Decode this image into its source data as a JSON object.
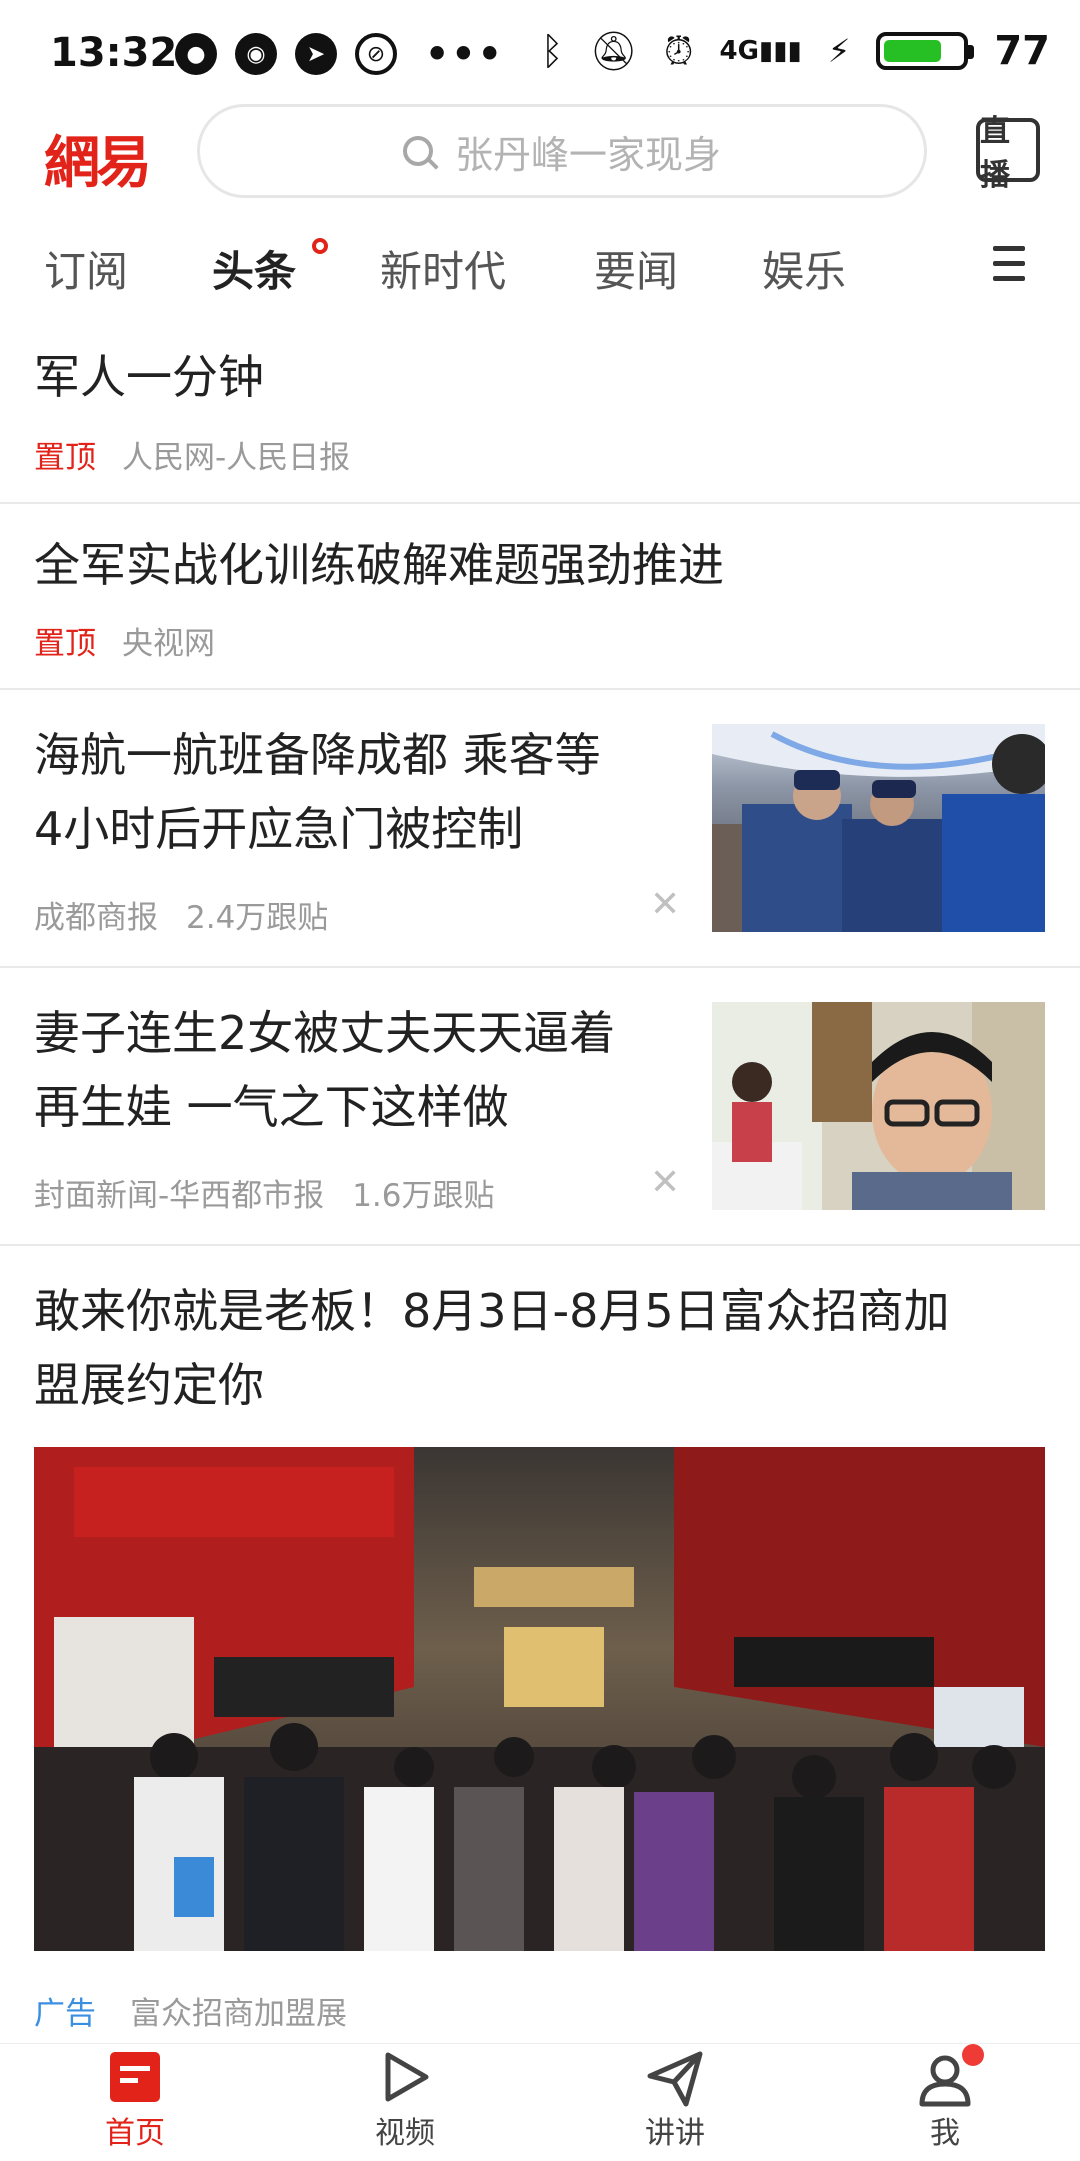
{
  "status_bar": {
    "time": "13:32",
    "network": "4G",
    "battery": "77",
    "battery_level": 0.77
  },
  "header": {
    "logo": "網易",
    "search_placeholder": "张丹峰一家现身",
    "live_label": "直播"
  },
  "tabs": [
    "订阅",
    "头条",
    "新时代",
    "要闻",
    "娱乐"
  ],
  "active_tab_index": 1,
  "feed": [
    {
      "title": "军人一分钟",
      "pin": "置顶",
      "source": "人民网-人民日报"
    },
    {
      "title": "全军实战化训练破解难题强劲推进",
      "pin": "置顶",
      "source": "央视网"
    },
    {
      "title_line1": "海航一航班备降成都 乘客等",
      "title_line2": "4小时后开应急门被控制",
      "source": "成都商报",
      "comments": "2.4万跟贴"
    },
    {
      "title_line1": "妻子连生2女被丈夫天天逼着",
      "title_line2": "再生娃 一气之下这样做",
      "source": "封面新闻-华西都市报",
      "comments": "1.6万跟贴"
    },
    {
      "title_line1": "敢来你就是老板！8月3日-8月5日富众招商加",
      "title_line2": "盟展约定你",
      "ad_label": "广告",
      "source": "富众招商加盟展"
    }
  ],
  "bottom_nav": [
    "首页",
    "视频",
    "讲讲",
    "我"
  ],
  "colors": {
    "brand_red": "#e2231a",
    "ad_blue": "#3b8fe0",
    "meta_gray": "#9a9a9a"
  }
}
